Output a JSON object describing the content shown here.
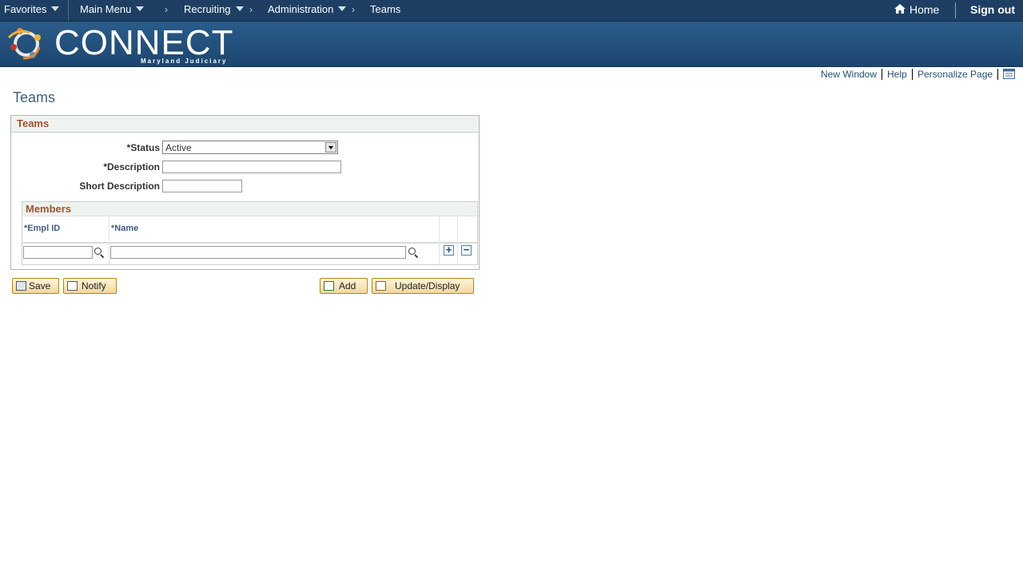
{
  "nav": {
    "favorites": "Favorites",
    "main_menu": "Main Menu",
    "breadcrumb": [
      "Recruiting",
      "Administration",
      "Teams"
    ],
    "home": "Home",
    "sign_out": "Sign out"
  },
  "banner": {
    "logo_text": "CONNECT",
    "logo_sub": "Maryland Judiciary"
  },
  "page_links": {
    "new_window": "New Window",
    "help": "Help",
    "personalize": "Personalize Page"
  },
  "page_title": "Teams",
  "teams_box": {
    "title": "Teams",
    "status_label": "*Status",
    "status_value": "Active",
    "description_label": "*Description",
    "description_value": "",
    "short_description_label": "Short Description",
    "short_description_value": ""
  },
  "members": {
    "title": "Members",
    "columns": [
      "*Empl ID",
      "*Name"
    ],
    "row": {
      "empl_id": "",
      "name": ""
    },
    "add_row": "+",
    "delete_row": "−"
  },
  "buttons": {
    "save": "Save",
    "notify": "Notify",
    "add": "Add",
    "update_display": "Update/Display"
  },
  "colors": {
    "nav_bg": "#1e3f63",
    "banner_bg": "#2b5c8a",
    "section_title": "#a0522d",
    "link": "#1f4e79",
    "button_bg": "#f3d79a"
  }
}
